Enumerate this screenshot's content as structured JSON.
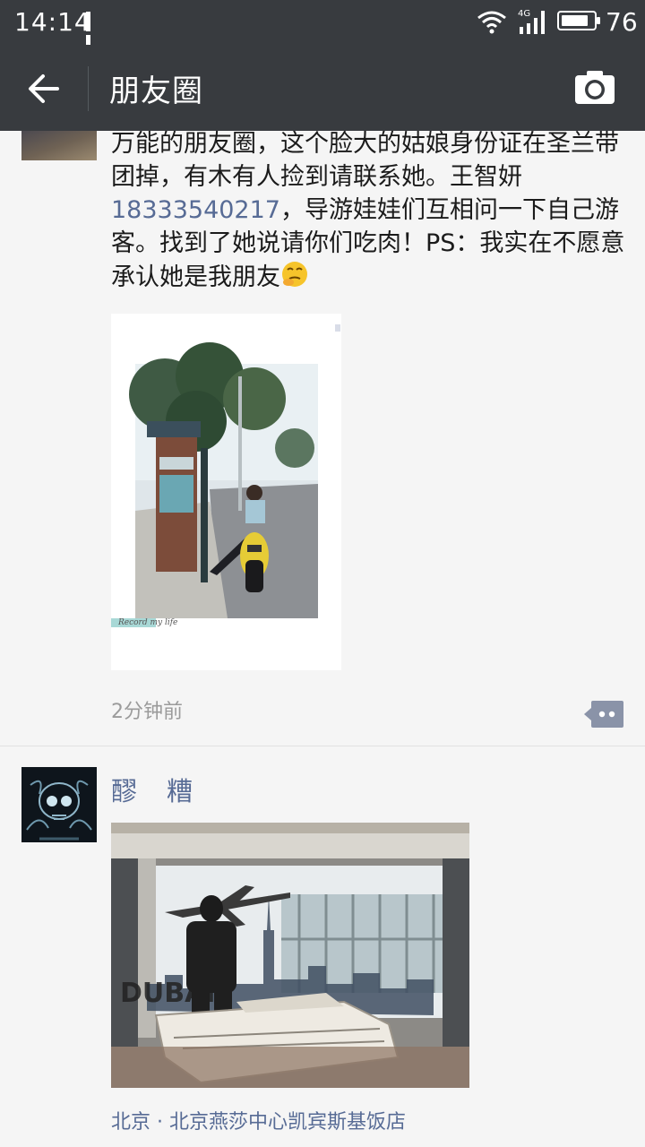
{
  "status_bar": {
    "time": "14:14",
    "network": "4G",
    "battery_level": "76"
  },
  "nav": {
    "title": "朋友圈"
  },
  "post1": {
    "text_before": "万能的朋友圈，这个脸大的姑娘身份证在圣兰带团掉，有木有人捡到请联系她。王智妍",
    "phone": "18333540217",
    "text_after": "，导游娃娃们互相问一下自己游客。找到了她说请你们吃肉！PS：我实在不愿意承认她是我朋友",
    "image_caption": "Record my life",
    "time": "2分钟前"
  },
  "post2": {
    "name": "醪　糟",
    "image_sign": "DUBAI",
    "location": "北京 · 北京燕莎中心凯宾斯基饭店"
  },
  "colors": {
    "bar": "#383b3f",
    "link": "#576b95",
    "background": "#f5f5f5",
    "muted": "#9b9b9b"
  },
  "icons": [
    "back-arrow-icon",
    "camera-icon",
    "wifi-icon",
    "signal-icon",
    "battery-icon",
    "comment-icon",
    "emoji-icon"
  ]
}
